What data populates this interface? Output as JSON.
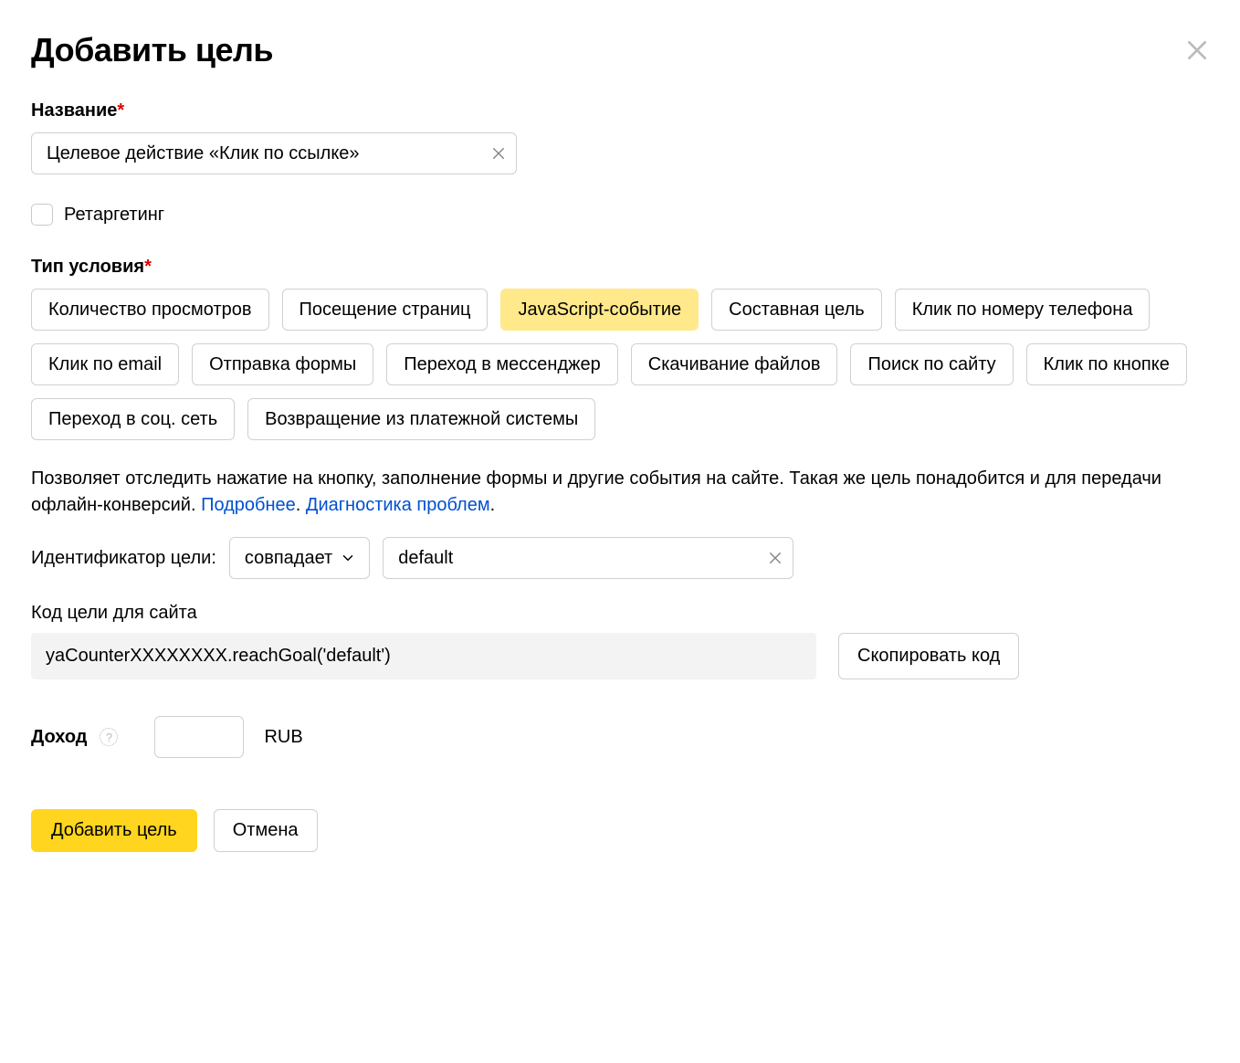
{
  "header": {
    "title": "Добавить цель"
  },
  "name": {
    "label": "Название",
    "value": "Целевое действие «Клик по ссылке»"
  },
  "retargeting": {
    "label": "Ретаргетинг",
    "checked": false
  },
  "condition": {
    "label": "Тип условия",
    "selected": 2,
    "options": [
      "Количество просмотров",
      "Посещение страниц",
      "JavaScript-событие",
      "Составная цель",
      "Клик по номеру телефона",
      "Клик по email",
      "Отправка формы",
      "Переход в мессенджер",
      "Скачивание файлов",
      "Поиск по сайту",
      "Клик по кнопке",
      "Переход в соц. сеть",
      "Возвращение из платежной системы"
    ]
  },
  "description": {
    "text_before": "Позволяет отследить нажатие на кнопку, заполнение формы и другие события на сайте. Такая же цель понадобится и для передачи офлайн-конверсий. ",
    "link1": "Подробнее",
    "sep": ". ",
    "link2": "Диагностика проблем",
    "tail": "."
  },
  "identifier": {
    "label": "Идентификатор цели:",
    "match": "совпадает",
    "value": "default"
  },
  "code": {
    "label": "Код цели для сайта",
    "value": "yaCounterXXXXXXXX.reachGoal('default')",
    "copy": "Скопировать код"
  },
  "income": {
    "label": "Доход",
    "value": "",
    "currency": "RUB"
  },
  "actions": {
    "submit": "Добавить цель",
    "cancel": "Отмена"
  }
}
